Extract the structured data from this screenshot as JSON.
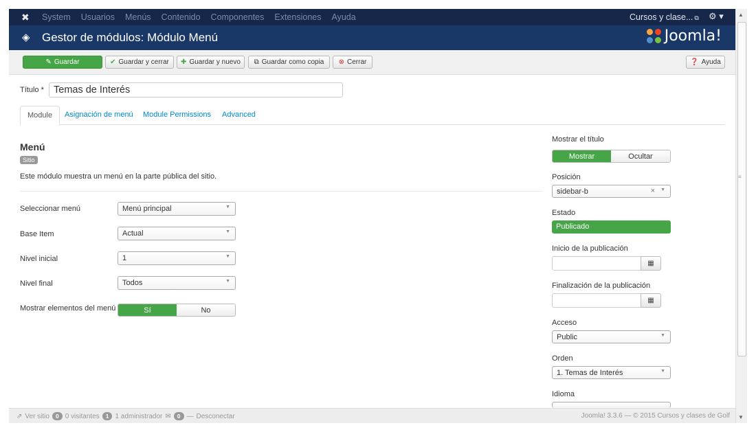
{
  "topbar": {
    "menu": [
      "System",
      "Usuarios",
      "Menús",
      "Contenido",
      "Componentes",
      "Extensiones",
      "Ayuda"
    ],
    "site_link": "Cursos y clase..."
  },
  "header": {
    "title": "Gestor de módulos: Módulo Menú",
    "brand": "Joomla!"
  },
  "toolbar": {
    "save": "Guardar",
    "save_close": "Guardar y cerrar",
    "save_new": "Guardar y nuevo",
    "save_copy": "Guardar como copia",
    "close": "Cerrar",
    "help": "Ayuda"
  },
  "title_field": {
    "label": "Título *",
    "value": "Temas de Interés"
  },
  "tabs": [
    "Module",
    "Asignación de menú",
    "Module Permissions",
    "Advanced"
  ],
  "module": {
    "heading": "Menú",
    "badge": "Sitio",
    "description": "Este módulo muestra un menú en la parte pública del sitio."
  },
  "fields": {
    "select_menu": {
      "label": "Seleccionar menú",
      "value": "Menú principal"
    },
    "base_item": {
      "label": "Base Item",
      "value": "Actual"
    },
    "start_level": {
      "label": "Nivel inicial",
      "value": "1"
    },
    "end_level": {
      "label": "Nivel final",
      "value": "Todos"
    },
    "show_sub": {
      "label": "Mostrar elementos del menú",
      "yes": "Sí",
      "no": "No",
      "selected": "Sí"
    }
  },
  "sidebar": {
    "show_title": {
      "label": "Mostrar el título",
      "on": "Mostrar",
      "off": "Ocultar",
      "selected": "Mostrar"
    },
    "position": {
      "label": "Posición",
      "value": "sidebar-b"
    },
    "status": {
      "label": "Estado",
      "value": "Publicado"
    },
    "publish_up": {
      "label": "Inicio de la publicación",
      "value": ""
    },
    "publish_down": {
      "label": "Finalización de la publicación",
      "value": ""
    },
    "access": {
      "label": "Acceso",
      "value": "Public"
    },
    "ordering": {
      "label": "Orden",
      "value": "1. Temas de Interés"
    },
    "language": {
      "label": "Idioma"
    }
  },
  "statusbar": {
    "view_site": "Ver sitio",
    "visitors_count": "0",
    "visitors": "0 visitantes",
    "admins_count": "1",
    "admins": "1 administrador",
    "messages_count": "0",
    "logout": "Desconectar",
    "footer": "Joomla! 3.3.6 — © 2015 Cursos y clases de Golf"
  },
  "colors": {
    "navbar": "#17274a",
    "header": "#1a3867",
    "success": "#46a546",
    "link": "#0088cc"
  }
}
